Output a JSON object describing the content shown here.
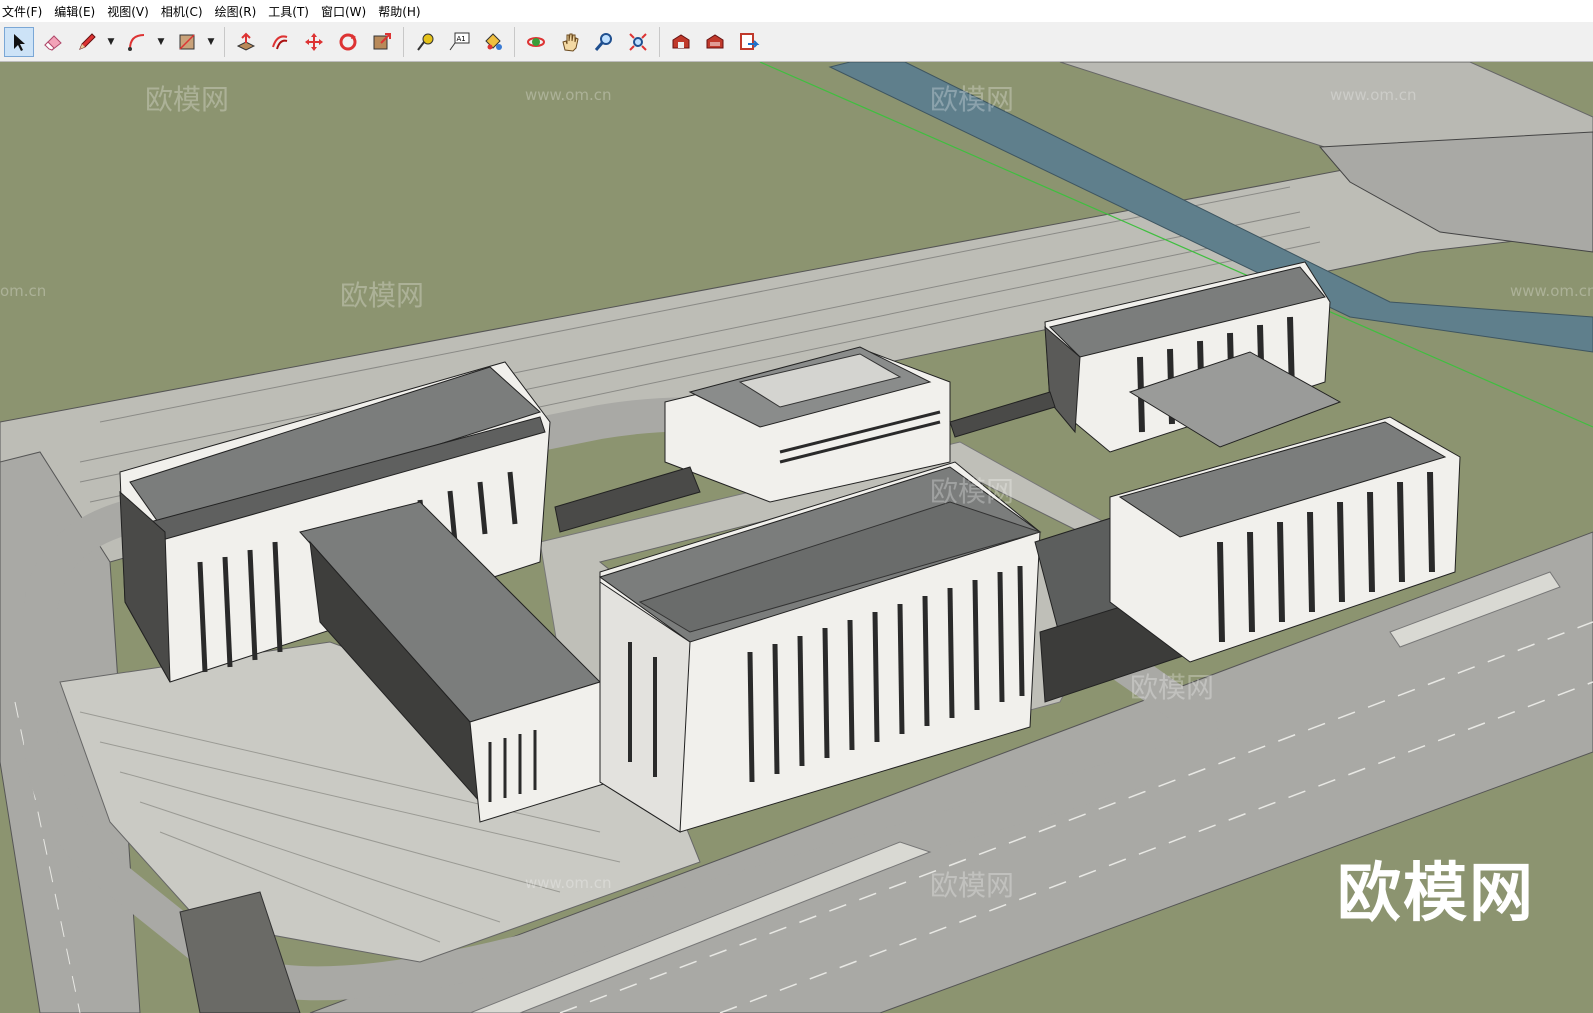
{
  "menu": {
    "items": [
      "文件(F)",
      "编辑(E)",
      "视图(V)",
      "相机(C)",
      "绘图(R)",
      "工具(T)",
      "窗口(W)",
      "帮助(H)"
    ]
  },
  "toolbar": {
    "tools": [
      {
        "name": "select",
        "icon": "arrow-icon",
        "active": true
      },
      {
        "name": "eraser",
        "icon": "eraser-icon"
      },
      {
        "name": "line",
        "icon": "pencil-icon",
        "dropdown": true
      },
      {
        "name": "arc",
        "icon": "arc-icon",
        "dropdown": true
      },
      {
        "name": "shape",
        "icon": "rectangle-icon",
        "dropdown": true
      },
      {
        "name": "push-pull",
        "icon": "push-pull-icon"
      },
      {
        "name": "offset",
        "icon": "offset-icon"
      },
      {
        "name": "move",
        "icon": "move-icon"
      },
      {
        "name": "rotate",
        "icon": "rotate-icon"
      },
      {
        "name": "scale",
        "icon": "scale-icon"
      },
      {
        "name": "tape-measure",
        "icon": "tape-icon"
      },
      {
        "name": "text",
        "icon": "text-icon",
        "label": "A1"
      },
      {
        "name": "paint-bucket",
        "icon": "paint-bucket-icon"
      },
      {
        "name": "orbit",
        "icon": "orbit-icon"
      },
      {
        "name": "pan",
        "icon": "hand-icon"
      },
      {
        "name": "zoom",
        "icon": "magnifier-icon"
      },
      {
        "name": "zoom-extents",
        "icon": "zoom-extents-icon"
      },
      {
        "name": "warehouse",
        "icon": "warehouse-icon"
      },
      {
        "name": "extension-warehouse",
        "icon": "extension-icon"
      },
      {
        "name": "layout",
        "icon": "send-to-layout-icon"
      }
    ]
  },
  "watermarks": {
    "small_cn": "欧模网",
    "small_url": "www.om.cn",
    "edge_url": "om.cn",
    "big": "欧模网"
  },
  "colors": {
    "ground": "#8c9470",
    "paving": "#c7c7c1",
    "road": "#a9a9a5",
    "roof": "#7b7d7c",
    "facade": "#f1f0ec",
    "water": "#5f7f8c",
    "axis_green": "#3fbf3f"
  }
}
